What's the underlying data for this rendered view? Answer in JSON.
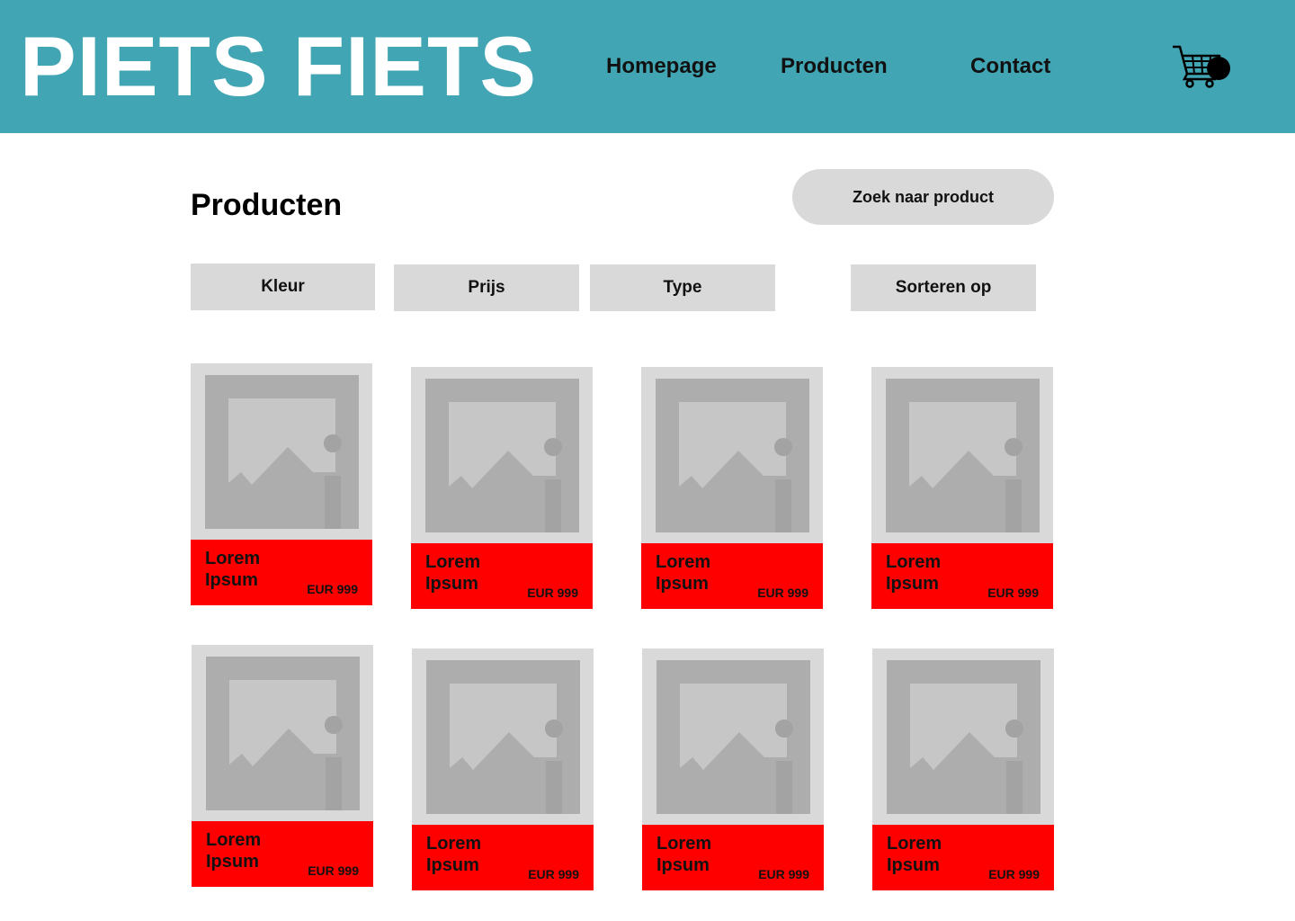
{
  "header": {
    "brand": "PIETS FIETS",
    "nav": [
      {
        "label": "Homepage"
      },
      {
        "label": "Producten"
      },
      {
        "label": "Contact"
      }
    ],
    "cart_icon": "shopping-cart-icon"
  },
  "main": {
    "title": "Producten",
    "search_button": "Zoek naar product",
    "filters": [
      {
        "label": "Kleur"
      },
      {
        "label": "Prijs"
      },
      {
        "label": "Type"
      }
    ],
    "sort_button": "Sorteren op"
  },
  "products": [
    {
      "name": "Lorem Ipsum",
      "price": "EUR 999",
      "image_icon": "image-placeholder-icon"
    },
    {
      "name": "Lorem Ipsum",
      "price": "EUR 999",
      "image_icon": "image-placeholder-icon"
    },
    {
      "name": "Lorem Ipsum",
      "price": "EUR 999",
      "image_icon": "image-placeholder-icon"
    },
    {
      "name": "Lorem Ipsum",
      "price": "EUR 999",
      "image_icon": "image-placeholder-icon"
    },
    {
      "name": "Lorem Ipsum",
      "price": "EUR 999",
      "image_icon": "image-placeholder-icon"
    },
    {
      "name": "Lorem Ipsum",
      "price": "EUR 999",
      "image_icon": "image-placeholder-icon"
    },
    {
      "name": "Lorem Ipsum",
      "price": "EUR 999",
      "image_icon": "image-placeholder-icon"
    },
    {
      "name": "Lorem Ipsum",
      "price": "EUR 999",
      "image_icon": "image-placeholder-icon"
    }
  ],
  "colors": {
    "header_bg": "#41a5b4",
    "card_footer": "#ff0000",
    "button_bg": "#d9d9d9"
  }
}
